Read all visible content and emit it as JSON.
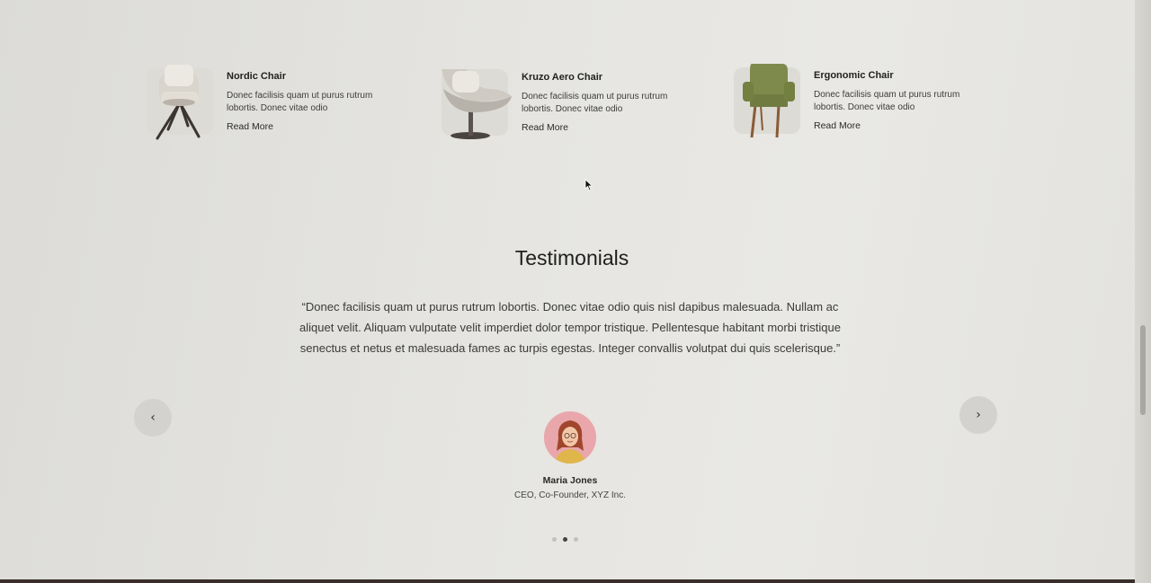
{
  "products": [
    {
      "name": "Nordic Chair",
      "description": "Donec facilisis quam ut purus rutrum lobortis. Donec vitae odio",
      "link": "Read More"
    },
    {
      "name": "Kruzo Aero Chair",
      "description": "Donec facilisis quam ut purus rutrum lobortis. Donec vitae odio",
      "link": "Read More"
    },
    {
      "name": "Ergonomic Chair",
      "description": "Donec facilisis quam ut purus rutrum lobortis. Donec vitae odio",
      "link": "Read More"
    }
  ],
  "testimonials": {
    "title": "Testimonials",
    "quote": "“Donec facilisis quam ut purus rutrum lobortis. Donec vitae odio quis nisl dapibus malesuada. Nullam ac aliquet velit. Aliquam vulputate velit imperdiet dolor tempor tristique. Pellentesque habitant morbi tristique senectus et netus et malesuada fames ac turpis egestas. Integer convallis volutpat dui quis scelerisque.”",
    "person_name": "Maria Jones",
    "person_role": "CEO, Co-Founder, XYZ Inc.",
    "prev_icon": "‹",
    "next_icon": "›",
    "active_slide": 2,
    "slide_count": 3
  },
  "colors": {
    "background": "#e6e5e1",
    "chair_green": "#7e8a4c",
    "chair_leg_dark": "#3b3430",
    "chair_leg_wood": "#8a5a34",
    "avatar_bg": "#e9a7ab"
  }
}
